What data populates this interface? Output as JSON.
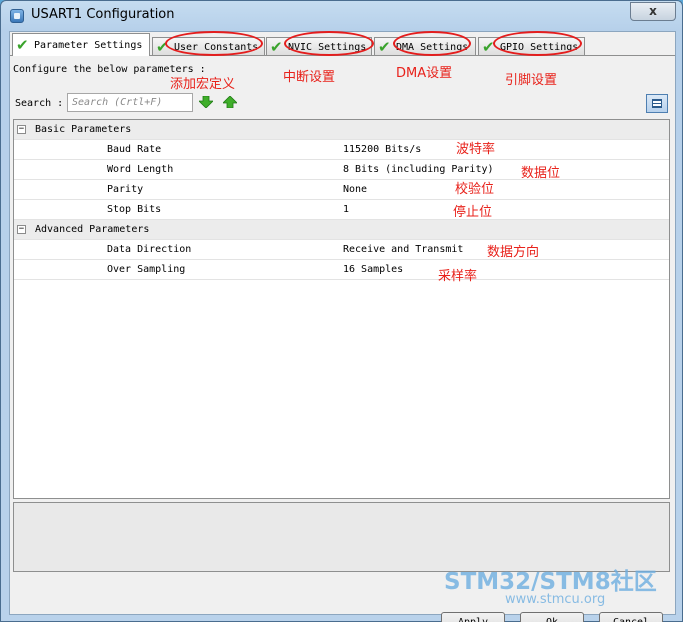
{
  "window": {
    "title": "USART1 Configuration",
    "close_label": "x"
  },
  "tabs": [
    {
      "label": "Parameter Settings",
      "active": true
    },
    {
      "label": "User Constants"
    },
    {
      "label": "NVIC Settings"
    },
    {
      "label": "DMA Settings"
    },
    {
      "label": "GPIO Settings"
    }
  ],
  "panel": {
    "configure_text": "Configure the below parameters :",
    "search_label": "Search :",
    "search_placeholder": "Search (Crtl+F)"
  },
  "groups": [
    {
      "label": "Basic Parameters",
      "params": [
        {
          "name": "Baud Rate",
          "value": "115200 Bits/s"
        },
        {
          "name": "Word Length",
          "value": "8 Bits (including Parity)"
        },
        {
          "name": "Parity",
          "value": "None"
        },
        {
          "name": "Stop Bits",
          "value": "1"
        }
      ]
    },
    {
      "label": "Advanced Parameters",
      "params": [
        {
          "name": "Data Direction",
          "value": "Receive and Transmit"
        },
        {
          "name": "Over Sampling",
          "value": "16 Samples"
        }
      ]
    }
  ],
  "buttons": {
    "apply": "Apply",
    "ok": "Ok",
    "cancel": "Cancel"
  },
  "annotations": {
    "user_constants": "添加宏定义",
    "nvic": "中断设置",
    "dma": "DMA设置",
    "gpio": "引脚设置",
    "baud_rate": "波特率",
    "word_length": "数据位",
    "parity": "校验位",
    "stop_bits": "停止位",
    "data_direction": "数据方向",
    "over_sampling": "采样率"
  },
  "watermark": {
    "main": "STM32/STM8社区",
    "sub": "www.stmcu.org"
  },
  "colors": {
    "annotation": "#e8221b",
    "check": "#3aa32c",
    "titlebar": "#c5dcf0"
  }
}
